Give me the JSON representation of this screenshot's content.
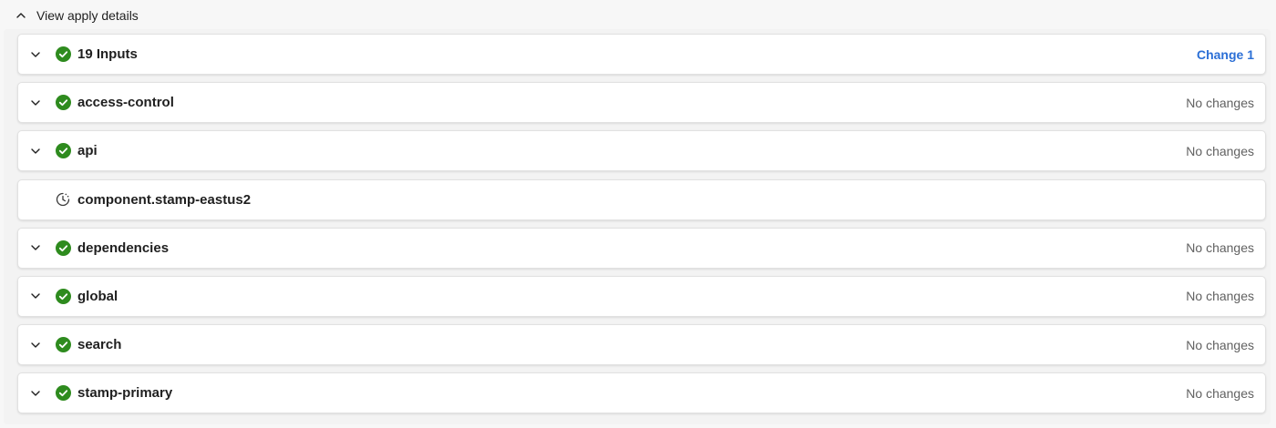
{
  "header": {
    "title": "View apply details",
    "icon": "chevron-up-icon"
  },
  "colors": {
    "success": "#2e8b1e",
    "link": "#2b6fd6",
    "muted": "#616161"
  },
  "rows": [
    {
      "name": "19 Inputs",
      "status": "success",
      "summary": "Change 1",
      "summary_is_link": true,
      "expandable": true
    },
    {
      "name": "access-control",
      "status": "success",
      "summary": "No changes",
      "summary_is_link": false,
      "expandable": true
    },
    {
      "name": "api",
      "status": "success",
      "summary": "No changes",
      "summary_is_link": false,
      "expandable": true
    },
    {
      "name": "component.stamp-eastus2",
      "status": "pending",
      "summary": "",
      "summary_is_link": false,
      "expandable": false
    },
    {
      "name": "dependencies",
      "status": "success",
      "summary": "No changes",
      "summary_is_link": false,
      "expandable": true
    },
    {
      "name": "global",
      "status": "success",
      "summary": "No changes",
      "summary_is_link": false,
      "expandable": true
    },
    {
      "name": "search",
      "status": "success",
      "summary": "No changes",
      "summary_is_link": false,
      "expandable": true
    },
    {
      "name": "stamp-primary",
      "status": "success",
      "summary": "No changes",
      "summary_is_link": false,
      "expandable": true
    }
  ]
}
